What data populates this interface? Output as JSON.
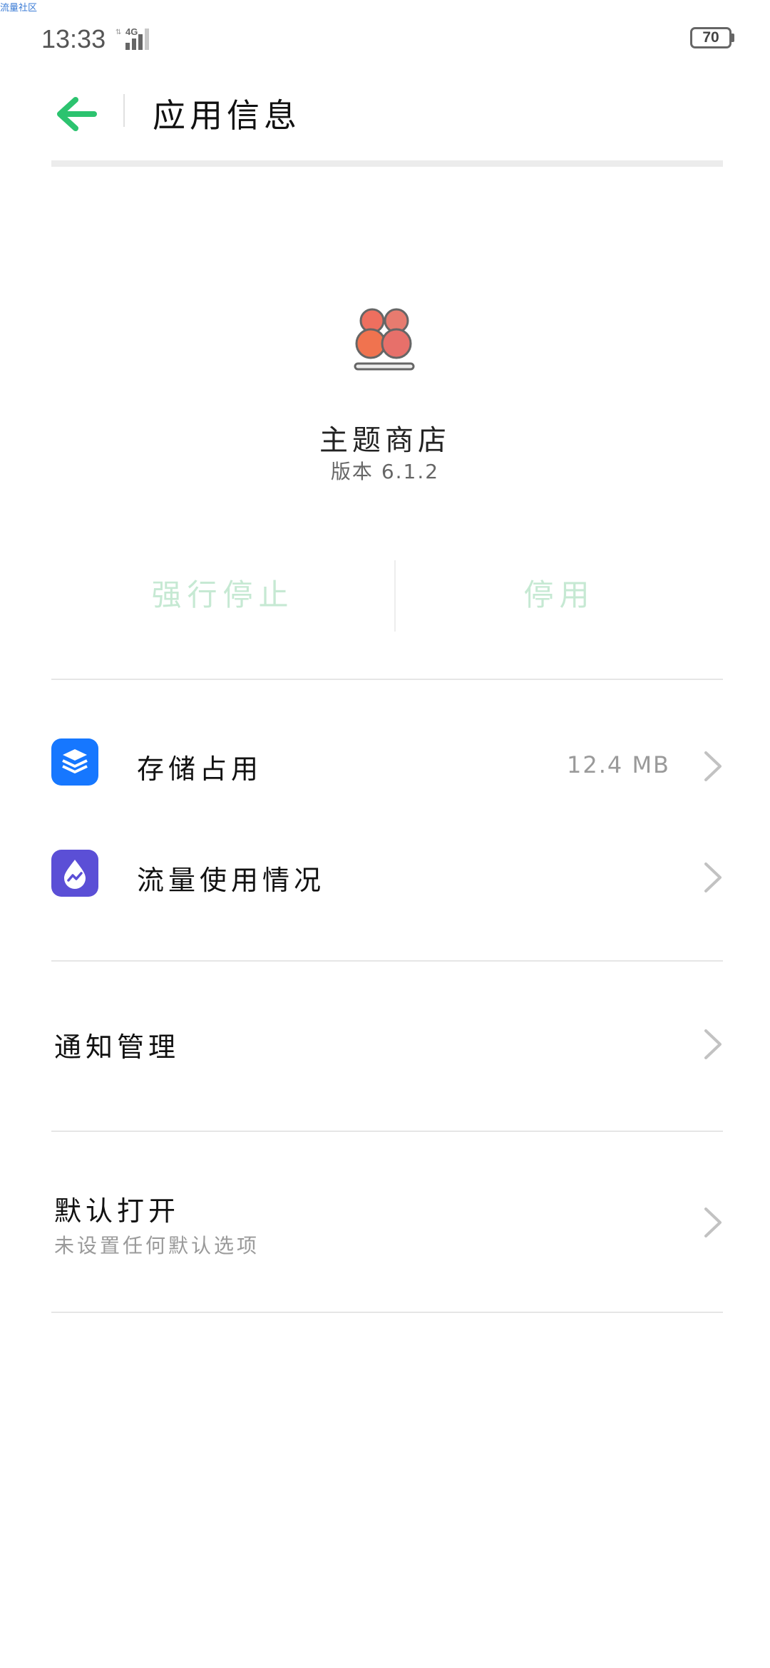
{
  "watermark": "流量社区",
  "status_bar": {
    "time": "13:33",
    "network": "4G",
    "battery": "70"
  },
  "header": {
    "title": "应用信息"
  },
  "app": {
    "name": "主题商店",
    "version": "版本 6.1.2"
  },
  "actions": {
    "force_stop": "强行停止",
    "disable": "停用"
  },
  "rows": {
    "storage": {
      "label": "存储占用",
      "value": "12.4 MB",
      "icon": "storage-layers-icon"
    },
    "data_usage": {
      "label": "流量使用情况",
      "icon": "data-usage-drop-icon"
    },
    "notifications": {
      "label": "通知管理"
    },
    "defaults": {
      "label": "默认打开",
      "sub": "未设置任何默认选项"
    }
  },
  "colors": {
    "accent": "#2cc36f",
    "storage_icon_bg": "#1677ff",
    "data_icon_bg": "#5b4fd6",
    "disabled_action": "#c6e9d3"
  }
}
